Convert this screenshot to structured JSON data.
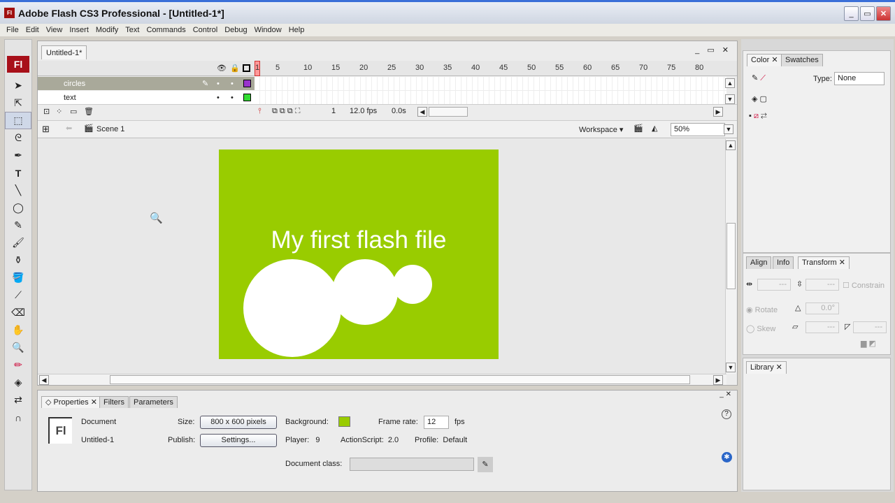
{
  "window": {
    "title": "Adobe Flash CS3 Professional - [Untitled-1*]",
    "logo": "Fl",
    "controls": [
      "minimize",
      "maximize",
      "close"
    ]
  },
  "menu": [
    "File",
    "Edit",
    "View",
    "Insert",
    "Modify",
    "Text",
    "Commands",
    "Control",
    "Debug",
    "Window",
    "Help"
  ],
  "tools": {
    "logo": "Fl",
    "items": [
      "selection-icon",
      "subselection-icon",
      "free-transform-icon",
      "lasso-icon",
      "pen-icon",
      "text-icon",
      "line-icon",
      "oval-icon",
      "pencil-icon",
      "brush-icon",
      "ink-bottle-icon",
      "paint-bucket-icon",
      "eyedropper-icon",
      "eraser-icon",
      "hand-icon",
      "zoom-icon"
    ],
    "text_glyph": "T"
  },
  "document": {
    "tab": "Untitled-1*"
  },
  "timeline": {
    "frame_numbers": [
      "1",
      "5",
      "10",
      "15",
      "20",
      "25",
      "30",
      "35",
      "40",
      "45",
      "50",
      "55",
      "60",
      "65",
      "70",
      "75",
      "80"
    ],
    "layers": [
      {
        "name": "circles",
        "color": "#9933cc",
        "selected": true
      },
      {
        "name": "text",
        "color": "#33dd33",
        "selected": false
      }
    ],
    "current_frame": "1",
    "frame_rate": "12.0 fps",
    "elapsed": "0.0s"
  },
  "editbar": {
    "scene": "Scene 1",
    "workspace": "Workspace ▾",
    "zoom": "50%"
  },
  "stage": {
    "background": "#99cc00",
    "text": "My first flash file"
  },
  "properties": {
    "tabs": [
      "Properties",
      "Filters",
      "Parameters"
    ],
    "icon_text": "Fl",
    "type": "Document",
    "name": "Untitled-1",
    "size_label": "Size:",
    "size_value": "800 x 600 pixels",
    "publish_label": "Publish:",
    "publish_button": "Settings...",
    "background_label": "Background:",
    "background_color": "#99cc00",
    "frame_rate_label": "Frame rate:",
    "frame_rate": "12",
    "fps": "fps",
    "player_label": "Player:",
    "player": "9",
    "actionscript_label": "ActionScript:",
    "actionscript": "2.0",
    "profile_label": "Profile:",
    "profile": "Default",
    "doc_class_label": "Document class:",
    "doc_class": ""
  },
  "color_panel": {
    "tabs": [
      "Color",
      "Swatches"
    ],
    "type_label": "Type:",
    "type_value": "None"
  },
  "transform_panel": {
    "tabs": [
      "Align",
      "Info",
      "Transform"
    ],
    "width": "---",
    "height": "---",
    "constrain": "Constrain",
    "rotate": "Rotate",
    "rotate_value": "0.0°",
    "skew": "Skew",
    "skew_h": "---",
    "skew_v": "---"
  },
  "library_panel": {
    "tabs": [
      "Library"
    ]
  }
}
